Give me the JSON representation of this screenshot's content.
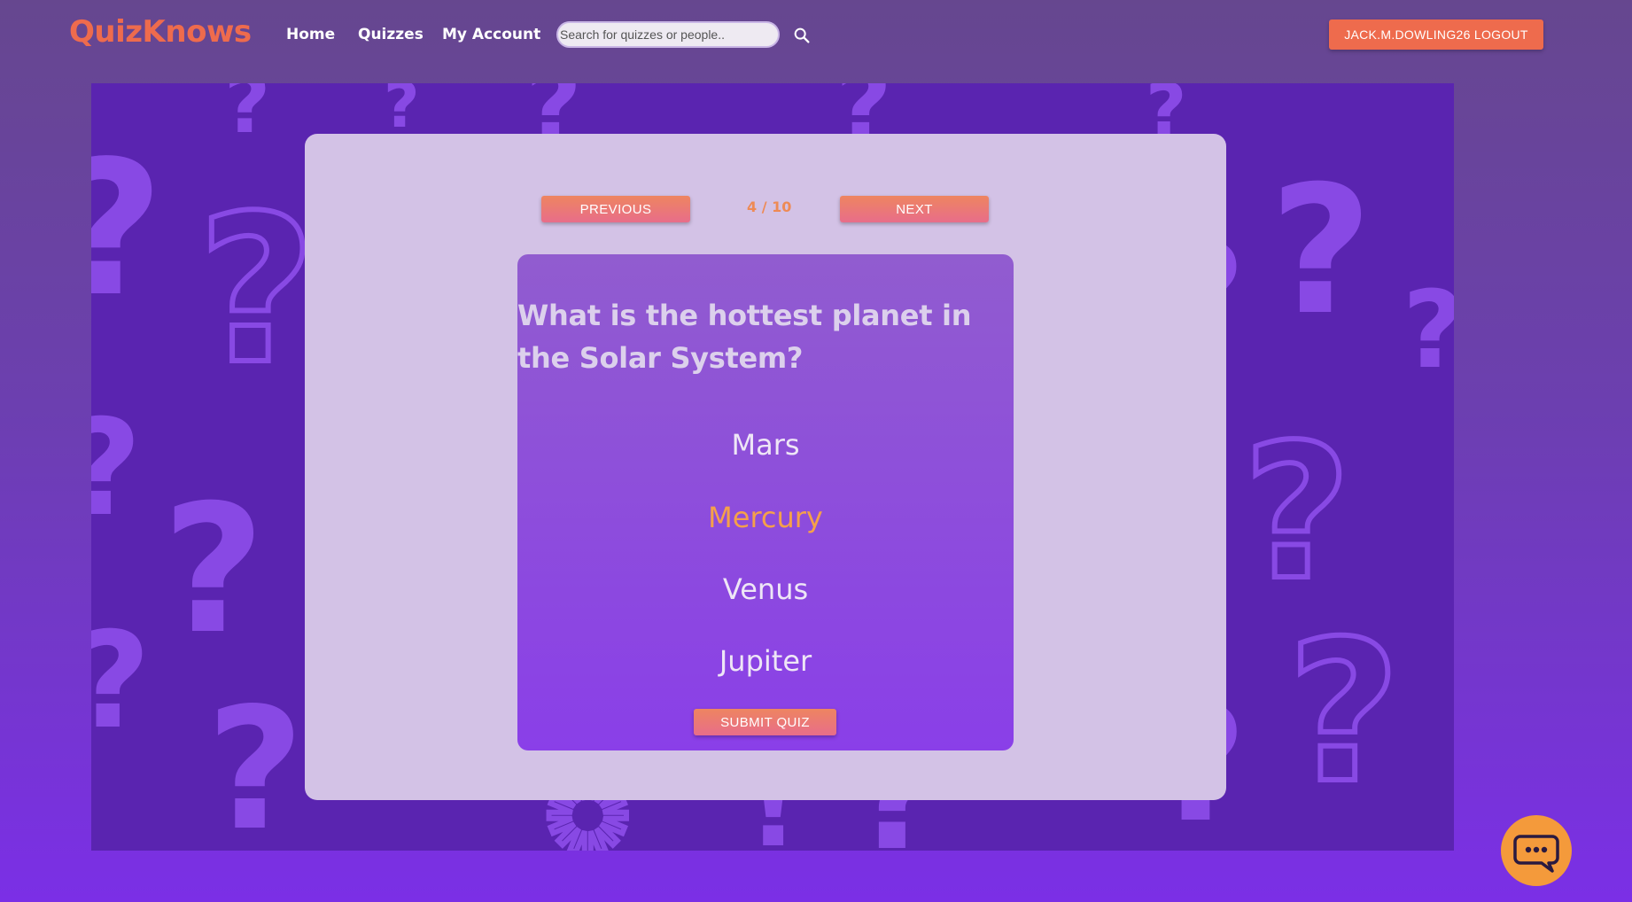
{
  "header": {
    "brand": "QuizKnows",
    "nav": [
      "Home",
      "Quizzes",
      "My Account"
    ],
    "search_placeholder": "Search for quizzes or people..",
    "logout_label": "JACK.M.DOWLING26 LOGOUT"
  },
  "quiz": {
    "previous_label": "PREVIOUS",
    "next_label": "NEXT",
    "progress": "4 / 10",
    "question": "What is the hottest planet in the Solar System?",
    "answers": [
      "Mars",
      "Mercury",
      "Venus",
      "Jupiter"
    ],
    "selected_answer": "Mercury",
    "submit_label": "SUBMIT QUIZ"
  },
  "colors": {
    "brand": "#ee6b4d",
    "selected_answer": "#f5a04a",
    "chat_button": "#f49a3b",
    "card": "#d3c2e6",
    "background_panel": "#5a24b0"
  },
  "icons": {
    "search": "search-icon",
    "chat": "chat-bubble-icon"
  }
}
